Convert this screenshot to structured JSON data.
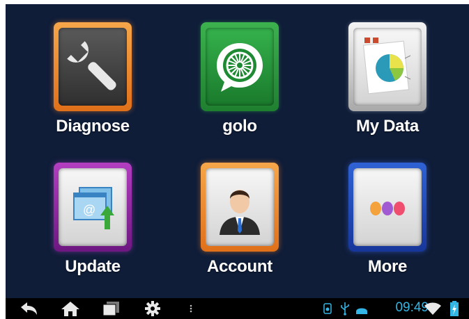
{
  "apps": [
    {
      "label": "Diagnose",
      "icon": "wrench-icon"
    },
    {
      "label": "golo",
      "icon": "golo-wheel-icon"
    },
    {
      "label": "My Data",
      "icon": "pie-chart-icon"
    },
    {
      "label": "Update",
      "icon": "update-window-icon"
    },
    {
      "label": "Account",
      "icon": "person-icon"
    },
    {
      "label": "More",
      "icon": "three-dots-icon"
    }
  ],
  "status_bar": {
    "time": "09:49",
    "icons": [
      "camera-notification-icon",
      "usb-icon",
      "android-debug-icon",
      "wifi-icon",
      "battery-charging-icon"
    ]
  },
  "nav_bar": {
    "icons": [
      "back-icon",
      "home-icon",
      "recent-apps-icon",
      "settings-icon",
      "menu-dots-icon"
    ]
  },
  "colors": {
    "background": "#0f1d39",
    "label": "#ffffff",
    "clock": "#33b5e5",
    "nav_bar": "#000000"
  }
}
